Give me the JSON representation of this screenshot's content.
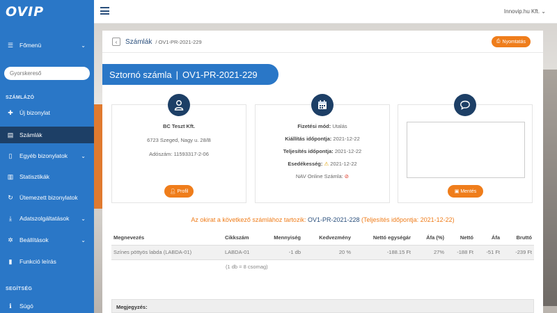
{
  "app": {
    "logo": "OVIP",
    "company": "Innovip.hu Kft."
  },
  "sidebar": {
    "main_menu": "Főmenü",
    "search_placeholder": "Gyorskereső",
    "section_billing": "SZÁMLÁZÓ",
    "items": [
      {
        "label": "Új bizonylat",
        "icon": "plus-icon"
      },
      {
        "label": "Számlák",
        "icon": "document-icon",
        "active": true
      },
      {
        "label": "Egyéb bizonylatok",
        "icon": "file-icon",
        "has_children": true
      },
      {
        "label": "Statisztikák",
        "icon": "bar-chart-icon"
      },
      {
        "label": "Ütemezett bizonylatok",
        "icon": "refresh-icon"
      },
      {
        "label": "Adatszolgáltatások",
        "icon": "download-icon",
        "has_children": true
      },
      {
        "label": "Beállítások",
        "icon": "gear-icon",
        "has_children": true
      },
      {
        "label": "Funkció leírás",
        "icon": "book-icon"
      }
    ],
    "section_help": "SEGÍTSÉG",
    "help_items": [
      {
        "label": "Súgó",
        "icon": "info-icon"
      }
    ]
  },
  "breadcrumb": {
    "link": "Számlák",
    "current": "/ OV1-PR-2021-229"
  },
  "print_button": "Nyomtatás",
  "title": {
    "type": "Sztornó számla",
    "number": "OV1-PR-2021-229"
  },
  "customer": {
    "name": "BC Teszt Kft.",
    "address": "6723 Szeged, Nagy u. 28/B",
    "tax_label": "Adószám:",
    "tax_number": "11593317-2-06",
    "profile_button": "Profil"
  },
  "payment": {
    "method_label": "Fizetési mód:",
    "method": "Utalás",
    "issue_label": "Kiállítás időpontja:",
    "issue_date": "2021-12-22",
    "perf_label": "Teljesítés időpontja:",
    "perf_date": "2021-12-22",
    "due_label": "Esedékesség:",
    "due_date": "2021-12-22",
    "nav_label": "NAV Online Számla:"
  },
  "note_panel": {
    "save_button": "Mentés"
  },
  "related": {
    "prefix": "Az okirat a következő számlához tartozik:",
    "code": "OV1-PR-2021-228",
    "suffix": "(Teljesítés időpontja: 2021-12-22)"
  },
  "table": {
    "headers": [
      "Megnevezés",
      "Cikkszám",
      "Mennyiség",
      "Kedvezmény",
      "Nettó egységár",
      "Áfa (%)",
      "Nettó",
      "Áfa",
      "Bruttó"
    ],
    "rows": [
      [
        "Színes pöttyös labda (LABDA-01)",
        "LABDA-01",
        "-1 db",
        "20 %",
        "-188.15 Ft",
        "27%",
        "-188 Ft",
        "-51 Ft",
        "-239 Ft"
      ]
    ],
    "sub_note": "(1 db = 8 csomag)"
  },
  "remark_label": "Megjegyzés:",
  "colors": {
    "primary": "#2a77c7",
    "dark": "#1d3f66",
    "accent": "#ef7d1b"
  }
}
